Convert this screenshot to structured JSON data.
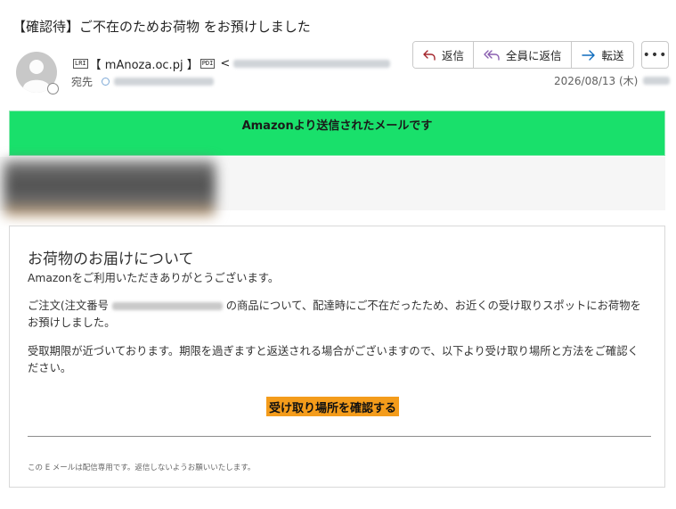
{
  "email": {
    "subject": "【確認待】ご不在のためお荷物 をお預けしました",
    "sender": {
      "ctl_prefix": "LRI",
      "name": "【 mAnoza.oc.pj 】",
      "ctl_suffix": "PDI",
      "angle_open": "<"
    },
    "to_label": "宛先",
    "date": "2026/08/13 (木)"
  },
  "actions": {
    "reply": "返信",
    "reply_all": "全員に返信",
    "forward": "転送",
    "more": "•••"
  },
  "body": {
    "banner": "Amazonより送信されたメールです",
    "title": "お荷物のお届けについて",
    "greeting": "Amazonをご利用いただきありがとうございます。",
    "order_prefix": "ご注文(注文番号",
    "order_suffix": "の商品について、配達時にご不在だったため、お近くの受け取りスポットにお荷物をお預けしました。",
    "deadline": "受取期限が近づいております。期限を過ぎますと返送される場合がございますので、以下より受け取り場所と方法をご確認ください。",
    "cta": "受け取り場所を確認する",
    "footer": "この E メールは配信専用です。返信しないようお願いいたします。"
  },
  "icons": {
    "reply": "reply-arrow-icon",
    "reply_all": "reply-all-arrow-icon",
    "forward": "forward-arrow-icon",
    "avatar": "person-icon",
    "presence": "presence-status-icon",
    "recipient": "recipient-status-icon"
  },
  "colors": {
    "banner": "#19e06b",
    "cta": "#f49c1b",
    "reply_icon": "#a4262c",
    "reply_all_icon": "#8a5fb0",
    "forward_icon": "#0f6cbd"
  }
}
